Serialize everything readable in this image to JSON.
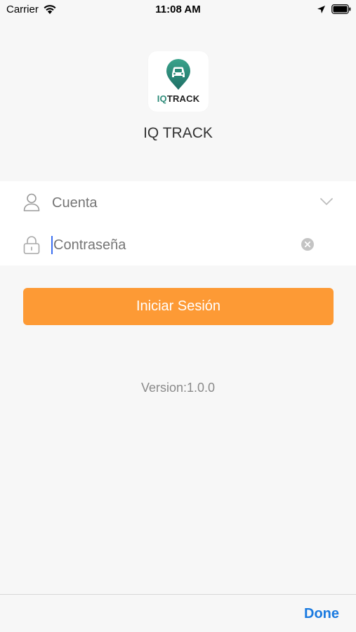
{
  "status_bar": {
    "carrier": "Carrier",
    "time": "11:08 AM"
  },
  "logo": {
    "text_iq": "IQ",
    "text_track": "TRACK"
  },
  "app_title": "IQ TRACK",
  "form": {
    "account_value": "Cuenta",
    "password_placeholder": "Contraseña"
  },
  "login_button_label": "Iniciar Sesión",
  "version_text": "Version:1.0.0",
  "toolbar": {
    "done_label": "Done"
  },
  "colors": {
    "accent": "#fd9a35",
    "link": "#1a7ae0",
    "brand": "#2f8c7a"
  }
}
